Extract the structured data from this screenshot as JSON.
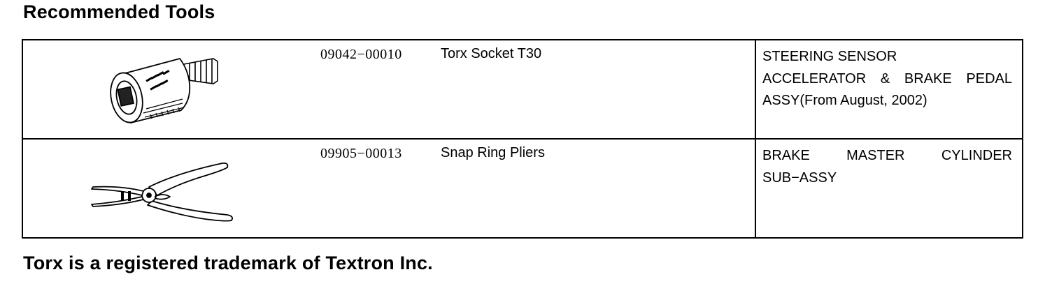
{
  "heading": "Recommended Tools",
  "tools": [
    {
      "part_number": "09042−00010",
      "name": "Torx Socket T30",
      "usage": [
        "STEERING SENSOR",
        "ACCELERATOR & BRAKE PEDAL",
        "ASSY(From August, 2002)"
      ],
      "illustration": "torx-socket-illustration"
    },
    {
      "part_number": "09905−00013",
      "name": "Snap Ring Pliers",
      "usage": [
        "BRAKE MASTER CYLINDER",
        "SUB−ASSY"
      ],
      "illustration": "snap-ring-pliers-illustration"
    }
  ],
  "footnote": "Torx is a registered trademark of Textron Inc."
}
